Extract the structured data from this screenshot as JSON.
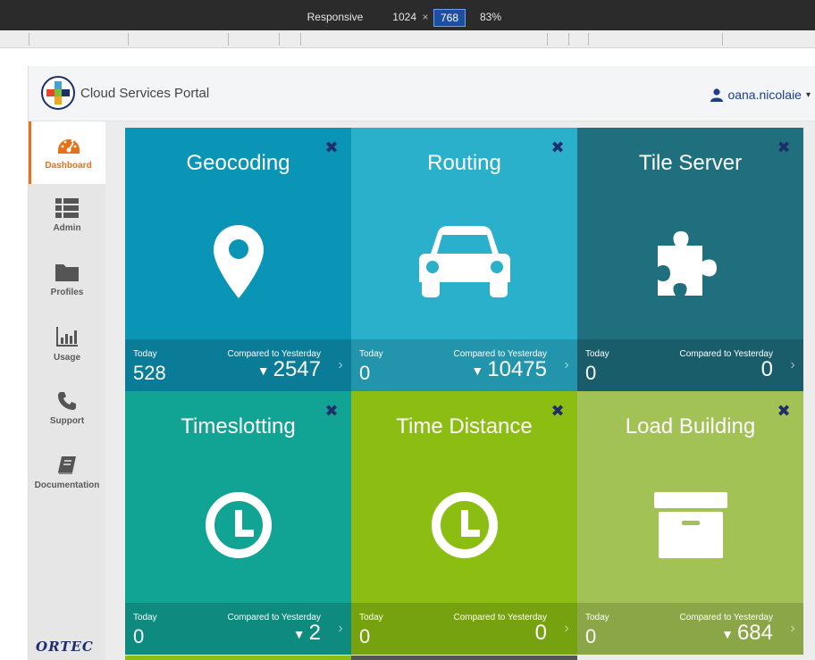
{
  "devtools": {
    "device": "Responsive",
    "width": "1024",
    "times": "×",
    "height": "768",
    "zoom": "83%"
  },
  "header": {
    "title": "Cloud Services Portal",
    "user": "oana.nicolaie",
    "caret": "▾"
  },
  "sidebar": {
    "items": [
      {
        "label": "Dashboard",
        "icon": "dashboard-icon"
      },
      {
        "label": "Admin",
        "icon": "list-icon"
      },
      {
        "label": "Profiles",
        "icon": "folder-icon"
      },
      {
        "label": "Usage",
        "icon": "bar-chart-icon"
      },
      {
        "label": "Support",
        "icon": "phone-icon"
      },
      {
        "label": "Documentation",
        "icon": "book-icon"
      }
    ],
    "brand": "ORTEC"
  },
  "tiles": [
    {
      "title": "Geocoding",
      "icon": "map-marker-icon",
      "color": "#0a94b5",
      "footer_color": "#0a7c97",
      "today_label": "Today",
      "today": "528",
      "compare_label": "Compared to Yesterday",
      "compare_arrow": "▼",
      "compare": "2547"
    },
    {
      "title": "Routing",
      "icon": "car-icon",
      "color": "#2bb0cc",
      "footer_color": "#2295ad",
      "today_label": "Today",
      "today": "0",
      "compare_label": "Compared to Yesterday",
      "compare_arrow": "▼",
      "compare": "10475"
    },
    {
      "title": "Tile Server",
      "icon": "puzzle-icon",
      "color": "#1f6f7e",
      "footer_color": "#1a5d6a",
      "today_label": "Today",
      "today": "0",
      "compare_label": "Compared to Yesterday",
      "compare_arrow": "",
      "compare": "0"
    },
    {
      "title": "Timeslotting",
      "icon": "clock-icon",
      "color": "#11a495",
      "footer_color": "#0e8a7e",
      "today_label": "Today",
      "today": "0",
      "compare_label": "Compared to Yesterday",
      "compare_arrow": "▼",
      "compare": "2"
    },
    {
      "title": "Time Distance",
      "icon": "clock-icon",
      "color": "#8cbd12",
      "footer_color": "#77a20f",
      "today_label": "Today",
      "today": "0",
      "compare_label": "Compared to Yesterday",
      "compare_arrow": "",
      "compare": "0"
    },
    {
      "title": "Load Building",
      "icon": "archive-box-icon",
      "color": "#a3c255",
      "footer_color": "#8ba646",
      "today_label": "Today",
      "today": "0",
      "compare_label": "Compared to Yesterday",
      "compare_arrow": "▼",
      "compare": "684"
    }
  ],
  "close_glyph": "✖",
  "more_glyph": "›"
}
